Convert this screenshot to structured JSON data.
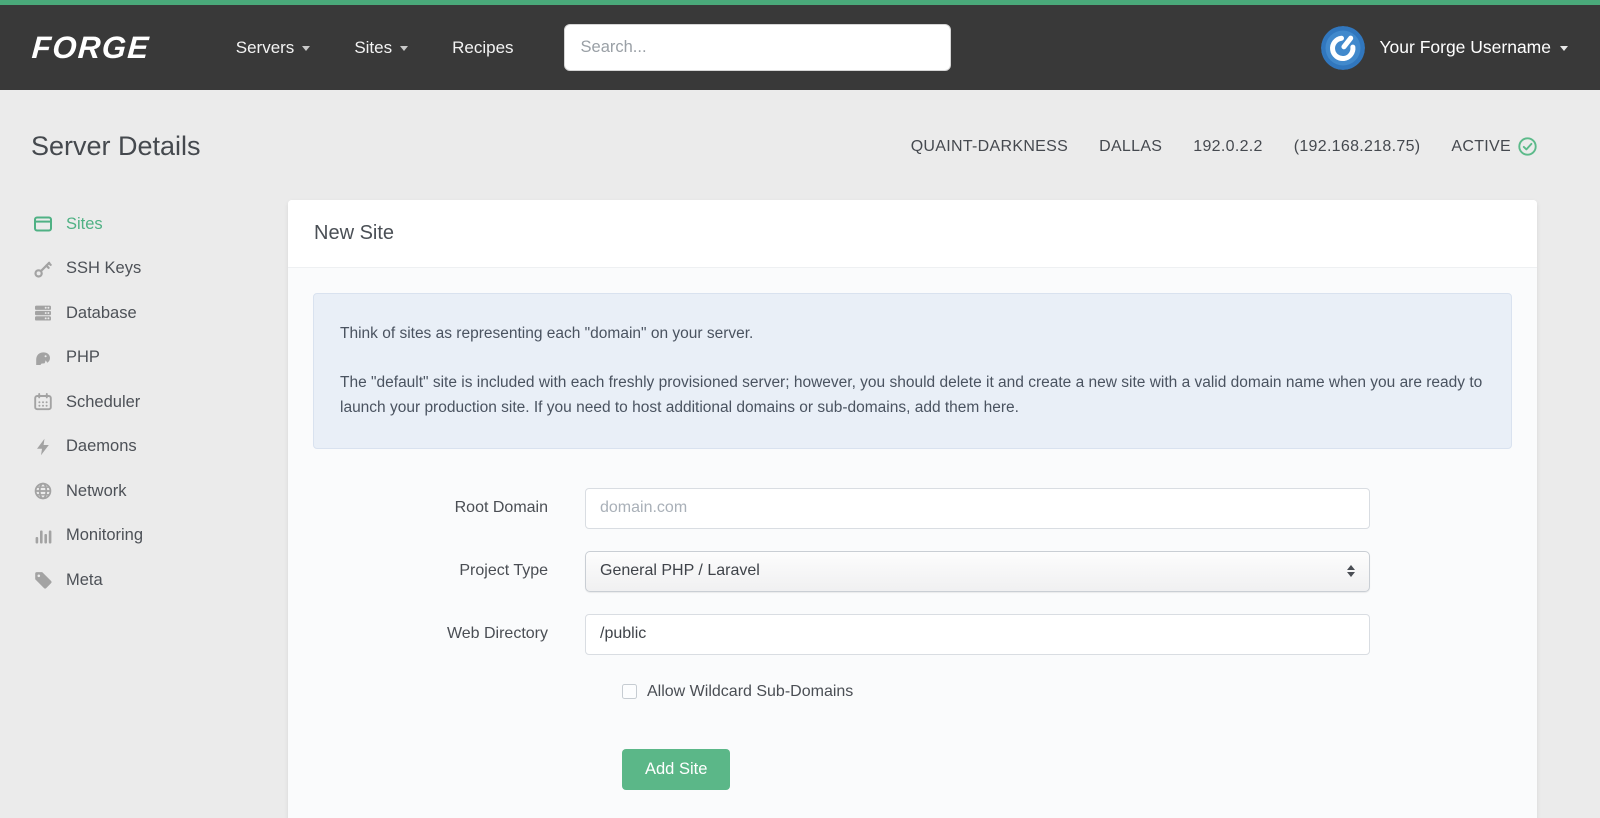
{
  "navbar": {
    "logo": "FORGE",
    "links": [
      {
        "label": "Servers"
      },
      {
        "label": "Sites"
      },
      {
        "label": "Recipes"
      }
    ],
    "search_placeholder": "Search...",
    "username": "Your Forge Username"
  },
  "header": {
    "title": "Server Details",
    "server_name": "QUAINT-DARKNESS",
    "region": "DALLAS",
    "ip": "192.0.2.2",
    "private_ip": "(192.168.218.75)",
    "status": "ACTIVE"
  },
  "sidebar": {
    "items": [
      {
        "label": "Sites",
        "icon": "window-icon",
        "active": true
      },
      {
        "label": "SSH Keys",
        "icon": "key-icon",
        "active": false
      },
      {
        "label": "Database",
        "icon": "database-icon",
        "active": false
      },
      {
        "label": "PHP",
        "icon": "elephant-icon",
        "active": false
      },
      {
        "label": "Scheduler",
        "icon": "calendar-icon",
        "active": false
      },
      {
        "label": "Daemons",
        "icon": "bolt-icon",
        "active": false
      },
      {
        "label": "Network",
        "icon": "globe-icon",
        "active": false
      },
      {
        "label": "Monitoring",
        "icon": "bar-chart-icon",
        "active": false
      },
      {
        "label": "Meta",
        "icon": "tag-icon",
        "active": false
      }
    ]
  },
  "card": {
    "title": "New Site",
    "info": {
      "p1": "Think of sites as representing each \"domain\" on your server.",
      "p2": "The \"default\" site is included with each freshly provisioned server; however, you should delete it and create a new site with a valid domain name when you are ready to launch your production site. If you need to host additional domains or sub-domains, add them here."
    },
    "form": {
      "root_domain": {
        "label": "Root Domain",
        "placeholder": "domain.com"
      },
      "project_type": {
        "label": "Project Type",
        "value": "General PHP / Laravel"
      },
      "web_directory": {
        "label": "Web Directory",
        "value": "/public"
      },
      "wildcard_label": "Allow Wildcard Sub-Domains",
      "submit_label": "Add Site"
    }
  },
  "colors": {
    "brand_green": "#4aa97a",
    "button_green": "#5bb788",
    "status_green": "#5cba8a",
    "active_sidebar_green": "#4fb184",
    "navbar_bg": "#393939",
    "avatar_blue": "#3177be",
    "info_box_bg": "#e9eff7",
    "page_bg": "#ebebeb"
  }
}
